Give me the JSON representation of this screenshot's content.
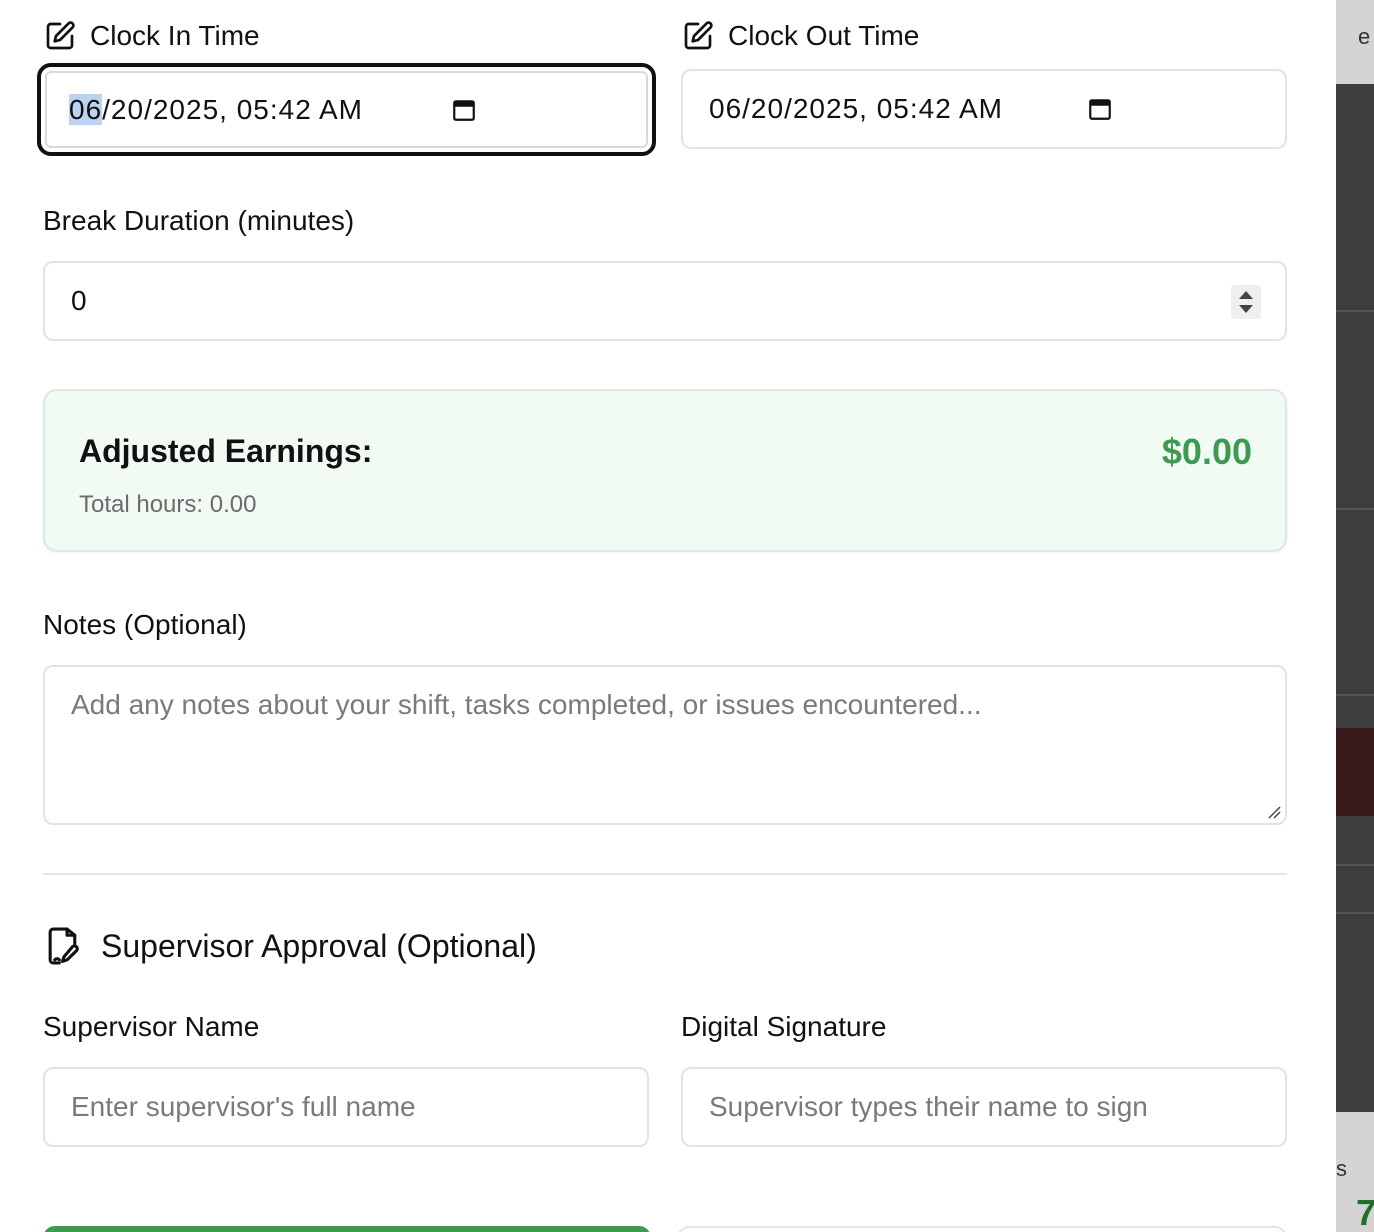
{
  "clock_in": {
    "label": "Clock In Time",
    "month": "06",
    "rest": "/20/2025, 05:42  AM"
  },
  "clock_out": {
    "label": "Clock Out Time",
    "value": "06/20/2025, 05:42  AM"
  },
  "break": {
    "label": "Break Duration (minutes)",
    "value": "0"
  },
  "earnings": {
    "title": "Adjusted Earnings:",
    "amount": "$0.00",
    "hours": "Total hours: 0.00",
    "amount_color": "#3f9a51",
    "background": "#f1faf3"
  },
  "notes": {
    "label": "Notes (Optional)",
    "placeholder": "Add any notes about your shift, tasks completed, or issues encountered..."
  },
  "supervisor": {
    "section_title": "Supervisor Approval (Optional)",
    "name_label": "Supervisor Name",
    "name_placeholder": "Enter supervisor's full name",
    "signature_label": "Digital Signature",
    "signature_placeholder": "Supervisor types their name to sign"
  },
  "backdrop": {
    "top_text": "e",
    "bottom_text": "s",
    "bottom_number": "7"
  },
  "icons": {
    "edit": "edit-icon",
    "calendar": "calendar-icon",
    "signature": "file-signature-icon"
  }
}
